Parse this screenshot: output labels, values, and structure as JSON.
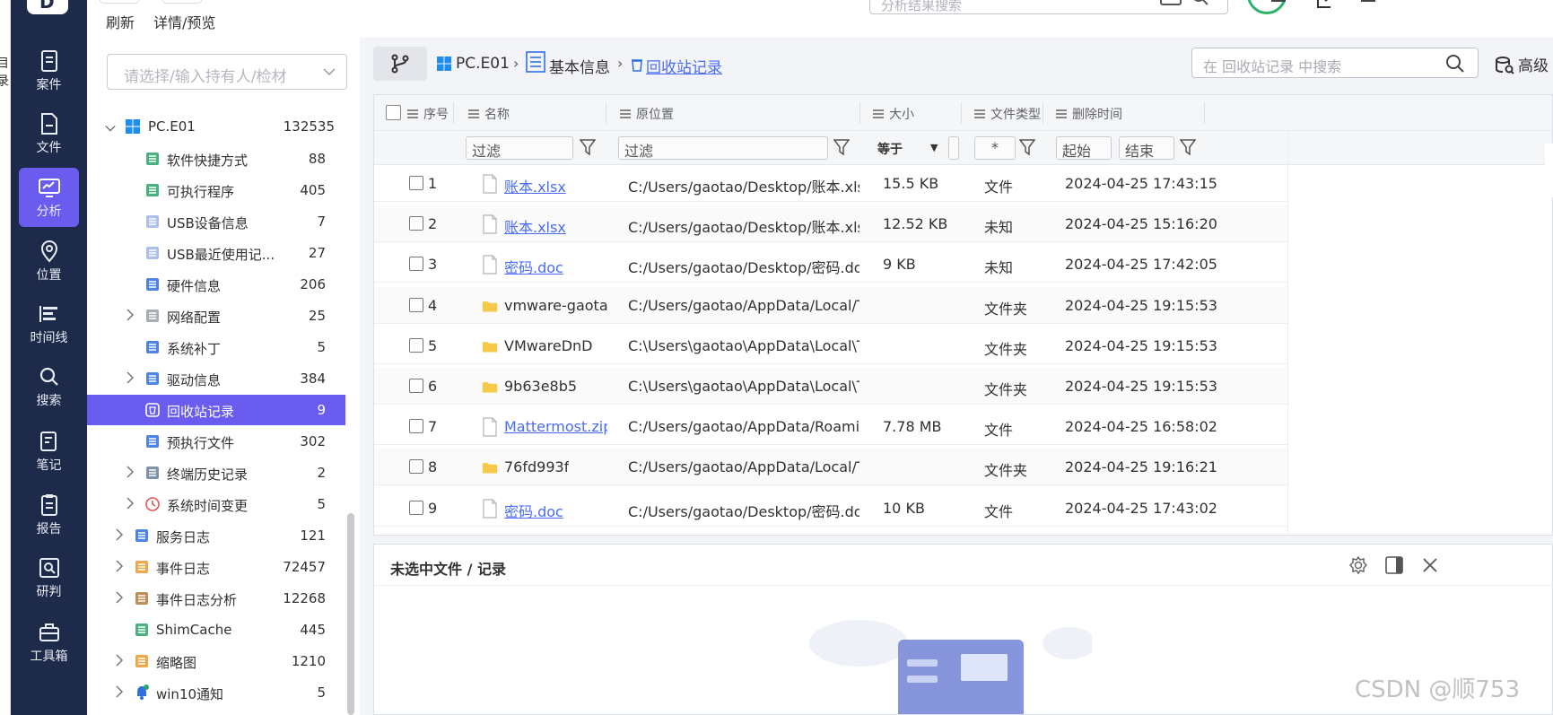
{
  "left_edge_text": "目录",
  "rail": {
    "items": [
      {
        "label": "案件",
        "icon": "case-icon"
      },
      {
        "label": "文件",
        "icon": "file-icon"
      },
      {
        "label": "分析",
        "icon": "analysis-icon",
        "active": true
      },
      {
        "label": "位置",
        "icon": "location-icon"
      },
      {
        "label": "时间线",
        "icon": "timeline-icon"
      },
      {
        "label": "搜索",
        "icon": "search-icon"
      },
      {
        "label": "笔记",
        "icon": "note-icon"
      },
      {
        "label": "报告",
        "icon": "report-icon"
      },
      {
        "label": "研判",
        "icon": "judge-icon"
      },
      {
        "label": "工具箱",
        "icon": "toolbox-icon"
      }
    ]
  },
  "toolbar": {
    "refresh_label": "刷新",
    "detail_label": "详情/预览",
    "search_placeholder": "分析结果搜索"
  },
  "tree": {
    "owner_placeholder": "请选择/输入持有人/检材",
    "root": {
      "label": "PC.E01",
      "count": "132535"
    },
    "items": [
      {
        "label": "软件快捷方式",
        "count": "88",
        "icon": "shortcut-icon",
        "expandable": false
      },
      {
        "label": "可执行程序",
        "count": "405",
        "icon": "exe-icon",
        "expandable": false
      },
      {
        "label": "USB设备信息",
        "count": "7",
        "icon": "usb-icon",
        "expandable": false
      },
      {
        "label": "USB最近使用记...",
        "count": "27",
        "icon": "usb-icon",
        "expandable": false
      },
      {
        "label": "硬件信息",
        "count": "206",
        "icon": "chip-icon",
        "expandable": false
      },
      {
        "label": "网络配置",
        "count": "25",
        "icon": "network-icon",
        "expandable": true
      },
      {
        "label": "系统补丁",
        "count": "5",
        "icon": "patch-icon",
        "expandable": false
      },
      {
        "label": "驱动信息",
        "count": "384",
        "icon": "driver-icon",
        "expandable": true
      },
      {
        "label": "回收站记录",
        "count": "9",
        "icon": "recycle-bin-icon",
        "expandable": false,
        "active": true
      },
      {
        "label": "预执行文件",
        "count": "302",
        "icon": "prefetch-icon",
        "expandable": false
      },
      {
        "label": "终端历史记录",
        "count": "2",
        "icon": "terminal-icon",
        "expandable": true
      },
      {
        "label": "系统时间变更",
        "count": "5",
        "icon": "clock-icon",
        "expandable": true
      }
    ],
    "items2": [
      {
        "label": "服务日志",
        "count": "121",
        "icon": "service-log-icon",
        "expandable": true
      },
      {
        "label": "事件日志",
        "count": "72457",
        "icon": "event-log-icon",
        "expandable": true
      },
      {
        "label": "事件日志分析",
        "count": "12268",
        "icon": "event-analysis-icon",
        "expandable": true
      },
      {
        "label": "ShimCache",
        "count": "445",
        "icon": "shimcache-icon",
        "expandable": false
      },
      {
        "label": "缩略图",
        "count": "1210",
        "icon": "thumbnail-icon",
        "expandable": true
      },
      {
        "label": "win10通知",
        "count": "5",
        "icon": "bell-icon",
        "expandable": true
      }
    ]
  },
  "breadcrumb": {
    "items": [
      "PC.E01",
      "基本信息",
      "回收站记录"
    ],
    "search_placeholder": "在 回收站记录 中搜索",
    "advanced_label": "高级"
  },
  "grid": {
    "headers": [
      "序号",
      "名称",
      "原位置",
      "大小",
      "文件类型",
      "删除时间"
    ],
    "filter_placeholder": "过滤",
    "size_op": "等于",
    "type_filter": "*",
    "start_label": "起始",
    "end_label": "结束",
    "rows": [
      {
        "idx": "1",
        "name": "账本.xlsx",
        "path": "C:/Users/gaotao/Desktop/账本.xlsx",
        "size": "15.5 KB",
        "type": "文件",
        "time": "2024-04-25 17:43:15",
        "kind": "file"
      },
      {
        "idx": "2",
        "name": "账本.xlsx",
        "path": "C:/Users/gaotao/Desktop/账本.xlsx",
        "size": "12.52 KB",
        "type": "未知",
        "time": "2024-04-25 15:16:20",
        "kind": "file"
      },
      {
        "idx": "3",
        "name": "密码.doc",
        "path": "C:/Users/gaotao/Desktop/密码.doc",
        "size": "9 KB",
        "type": "未知",
        "time": "2024-04-25 17:42:05",
        "kind": "file"
      },
      {
        "idx": "4",
        "name": "vmware-gaotao",
        "path": "C:/Users/gaotao/AppData/Local/Te...",
        "size": "",
        "type": "文件夹",
        "time": "2024-04-25 19:15:53",
        "kind": "folder"
      },
      {
        "idx": "5",
        "name": "VMwareDnD",
        "path": "C:\\Users\\gaotao\\AppData\\Local\\Te...",
        "size": "",
        "type": "文件夹",
        "time": "2024-04-25 19:15:53",
        "kind": "folder"
      },
      {
        "idx": "6",
        "name": "9b63e8b5",
        "path": "C:\\Users\\gaotao\\AppData\\Local\\Te...",
        "size": "",
        "type": "文件夹",
        "time": "2024-04-25 19:15:53",
        "kind": "folder"
      },
      {
        "idx": "7",
        "name": "Mattermost.zip",
        "path": "C:/Users/gaotao/AppData/Roamin...",
        "size": "7.78 MB",
        "type": "文件",
        "time": "2024-04-25 16:58:02",
        "kind": "file"
      },
      {
        "idx": "8",
        "name": "76fd993f",
        "path": "C:/Users/gaotao/AppData/Local/Te...",
        "size": "",
        "type": "文件夹",
        "time": "2024-04-25 19:16:21",
        "kind": "folder"
      },
      {
        "idx": "9",
        "name": "密码.doc",
        "path": "C:/Users/gaotao/Desktop/密码.doc",
        "size": "10 KB",
        "type": "文件",
        "time": "2024-04-25 17:43:02",
        "kind": "file"
      }
    ]
  },
  "detail": {
    "title": "未选中文件 / 记录"
  },
  "watermark": "CSDN @顺753",
  "colors": {
    "accent": "#6b5cf0",
    "rail": "#1e2a4a",
    "link": "#4a6cf0",
    "folder": "#f7c948"
  }
}
